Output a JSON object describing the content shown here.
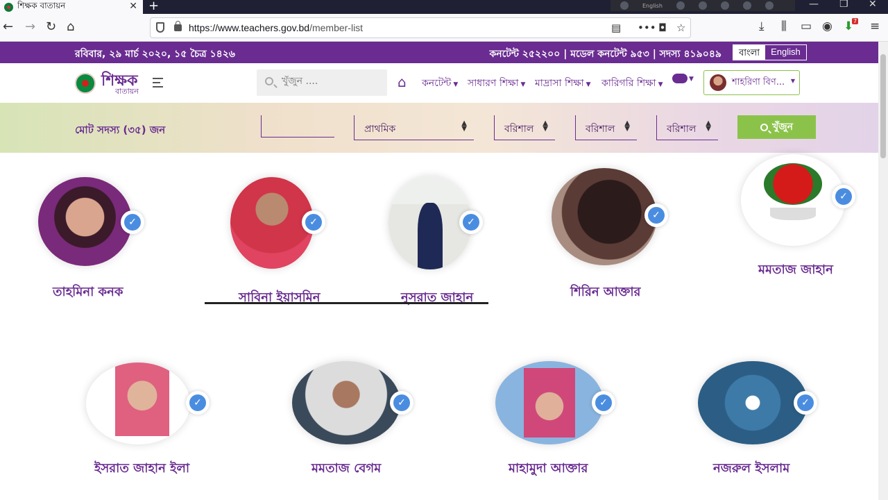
{
  "browser": {
    "tab_title": "শিক্ষক বাতায়ন",
    "tab_close": "✕",
    "new_tab": "+",
    "tray_lang": "English",
    "url_host": "https://www.teachers.gov.bd",
    "url_path": "/member-list",
    "download_badge": "7"
  },
  "header": {
    "date": "রবিবার, ২৯ মার্চ ২০২০, ১৫ চৈত্র ১৪২৬",
    "stats": "কনটেন্ট ২৫২২০০ | মডেল কনটেন্ট ৯৫৩ | সদস্য ৪১৯০৪৯",
    "lang_bn": "বাংলা",
    "lang_en": "English"
  },
  "site": {
    "logo_text": "শিক্ষক",
    "logo_sub": "বাতায়ন",
    "search_placeholder": "খুঁজুন ....",
    "menus": [
      "কনটেন্ট",
      "সাধারণ শিক্ষা",
      "মাদ্রাসা শিক্ষা",
      "কারিগরি শিক্ষা"
    ],
    "user_name": "শাহরিণা বিণ..."
  },
  "filter": {
    "total_members": "মোট সদস্য (৩৫) জন",
    "level": "প্রাথমিক",
    "division": "বরিশাল",
    "district": "বরিশাল",
    "upazila": "বরিশাল",
    "search_button": "খুঁজুন"
  },
  "members": [
    "তাহমিনা কনক",
    "সাবিনা ইয়াসমিন",
    "নুসরাত জাহান",
    "শিরিন আক্তার",
    "মমতাজ জাহান",
    "ইসরাত জাহান ইলা",
    "মমতাজ বেগম",
    "মাহামুদা আক্তার",
    "নজরুল ইসলাম"
  ],
  "colors": {
    "brand_purple": "#6a2c91",
    "accent_green": "#8bc34a",
    "verified_blue": "#4a8de0"
  }
}
